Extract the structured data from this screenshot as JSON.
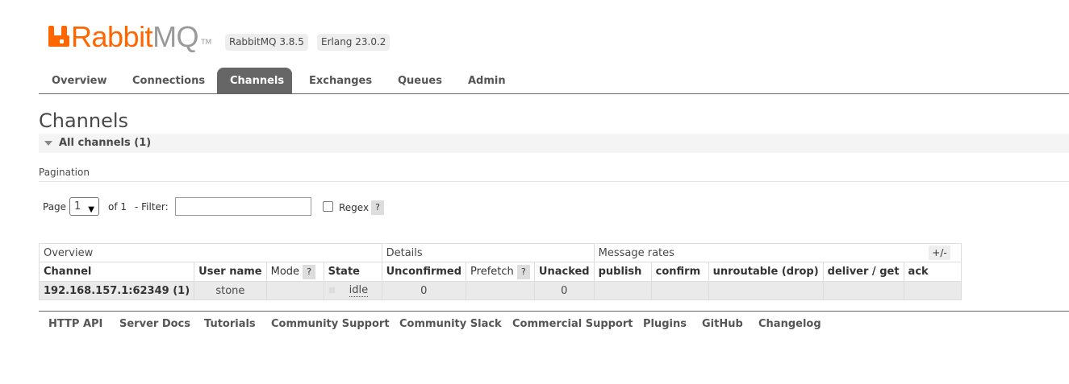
{
  "brand": {
    "name_primary": "Rabbit",
    "name_secondary": "MQ",
    "tm": "TM"
  },
  "versions": {
    "rabbitmq": "RabbitMQ 3.8.5",
    "erlang": "Erlang 23.0.2"
  },
  "nav": {
    "items": [
      {
        "label": "Overview",
        "active": false
      },
      {
        "label": "Connections",
        "active": false
      },
      {
        "label": "Channels",
        "active": true
      },
      {
        "label": "Exchanges",
        "active": false
      },
      {
        "label": "Queues",
        "active": false
      },
      {
        "label": "Admin",
        "active": false
      }
    ]
  },
  "page": {
    "title": "Channels",
    "section": "All channels (1)"
  },
  "pagination": {
    "label": "Pagination",
    "page_label": "Page",
    "page_value": "1",
    "of_label": "of 1",
    "filter_label": "- Filter:",
    "filter_value": "",
    "regex_label": "Regex",
    "help": "?"
  },
  "table": {
    "groups": [
      "Overview",
      "Details",
      "Message rates"
    ],
    "columns": {
      "channel": "Channel",
      "user": "User name",
      "mode": "Mode",
      "state": "State",
      "unconfirmed": "Unconfirmed",
      "prefetch": "Prefetch",
      "unacked": "Unacked",
      "publish": "publish",
      "confirm": "confirm",
      "unroutable": "unroutable (drop)",
      "deliver": "deliver / get",
      "ack": "ack"
    },
    "toggle": "+/-",
    "rows": [
      {
        "channel": "192.168.157.1:62349 (1)",
        "user": "stone",
        "mode": "",
        "state": "idle",
        "unconfirmed": "0",
        "prefetch": "",
        "unacked": "0",
        "publish": "",
        "confirm": "",
        "unroutable": "",
        "deliver": "",
        "ack": ""
      }
    ]
  },
  "footer": {
    "links": [
      "HTTP API",
      "Server Docs",
      "Tutorials",
      "Community Support",
      "Community Slack",
      "Commercial Support",
      "Plugins",
      "GitHub",
      "Changelog"
    ]
  },
  "colors": {
    "brand_orange": "#ff6600",
    "nav_active": "#666666"
  }
}
